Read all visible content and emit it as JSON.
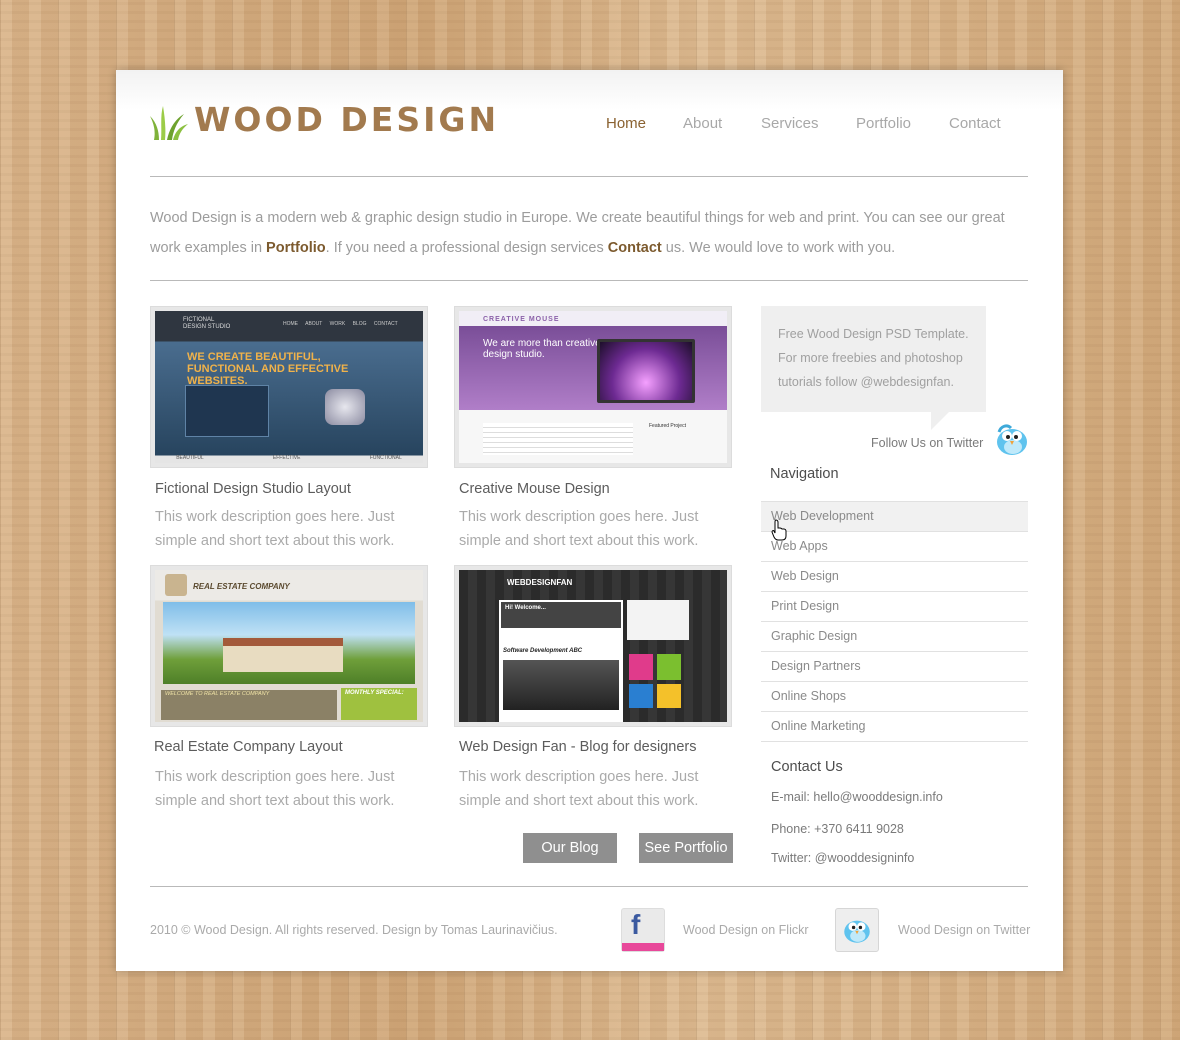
{
  "logo": {
    "text": "Wood Design"
  },
  "nav": {
    "items": [
      {
        "label": "Home",
        "active": true
      },
      {
        "label": "About"
      },
      {
        "label": "Services"
      },
      {
        "label": "Portfolio"
      },
      {
        "label": "Contact"
      }
    ]
  },
  "intro": {
    "part1": "Wood Design is a modern web & graphic design studio in Europe. We create beautiful things for web and print. You can see our great work examples in ",
    "link1": "Portfolio",
    "part2": ". If you need a professional design services ",
    "link2": "Contact",
    "part3": " us. We would love to work with you."
  },
  "portfolio": [
    {
      "title": "Fictional Design Studio Layout",
      "desc": "This work description goes here. Just simple and short text about this work.",
      "shot_headline": "WE CREATE BEAUTIFUL, FUNCTIONAL AND EFFECTIVE WEBSITES.",
      "shot_brand": "FICTIONAL DESIGN STUDIO",
      "shot_nav": [
        "HOME",
        "ABOUT",
        "WORK",
        "BLOG",
        "CONTACT"
      ],
      "shot_footer": [
        "BEAUTIFUL",
        "EFFECTIVE",
        "FUNCTIONAL"
      ]
    },
    {
      "title": "Creative Mouse Design",
      "desc": "This work description goes here. Just simple and short text about this work.",
      "shot_brand": "CREATIVE MOUSE",
      "shot_headline": "We are more than creative design studio.",
      "shot_featured": "Featured Project"
    },
    {
      "title": "Real Estate Company Layout",
      "desc": "This work description goes here. Just simple and short text about this work.",
      "shot_brand": "REAL ESTATE COMPANY",
      "shot_welcome": "WELCOME TO REAL ESTATE COMPANY",
      "shot_special": "MONTHLY SPECIAL:"
    },
    {
      "title": "Web Design Fan - Blog for designers",
      "desc": "This work description goes here. Just simple and short text about this work.",
      "shot_brand": "WEBDESIGNFAN",
      "shot_welcome": "Hi! Welcome...",
      "shot_post": "Software Development ABC"
    }
  ],
  "buttons": {
    "blog": "Our Blog",
    "portfolio": "See Portfolio"
  },
  "sidebar": {
    "bubble_text": "Free Wood Design PSD Template. For more freebies and photoshop tutorials follow @webdesignfan.",
    "follow_label": "Follow Us on Twitter",
    "nav_heading": "Navigation",
    "nav_items": [
      "Web Development",
      "Web Apps",
      "Web Design",
      "Print Design",
      "Graphic Design",
      "Design Partners",
      "Online Shops",
      "Online Marketing"
    ],
    "contact_heading": "Contact Us",
    "email": "E-mail: hello@wooddesign.info",
    "phone": "Phone: +370 6411 9028",
    "twitter": "Twitter: @wooddesigninfo"
  },
  "footer": {
    "copyright": "2010 © Wood Design. All rights reserved. Design by Tomas Laurinavičius.",
    "flickr_label": "Wood Design on Flickr",
    "twitter_label": "Wood Design on Twitter"
  },
  "colors": {
    "accent": "#8a6231",
    "logo": "#a27a4e",
    "button": "#8f8f8f"
  }
}
